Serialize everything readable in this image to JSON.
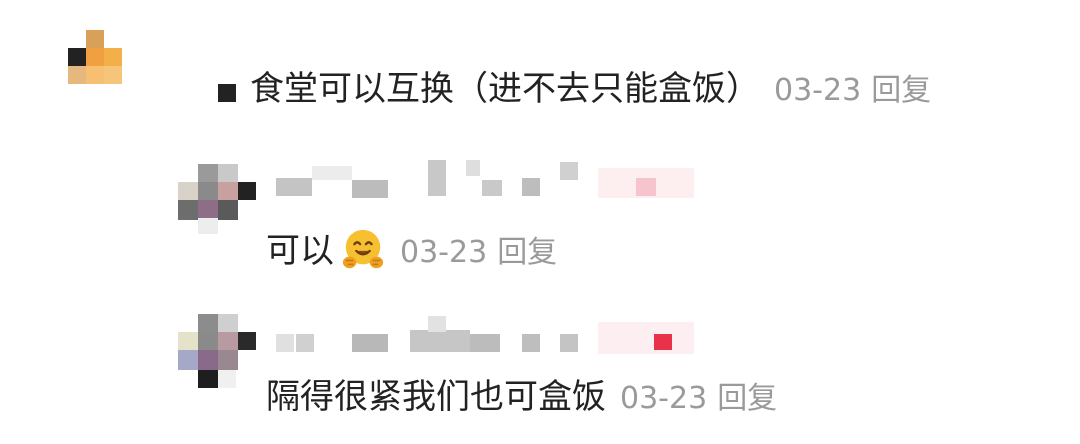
{
  "thread": {
    "top_comment": {
      "text": "食堂可以互换（进不去只能盒饭）",
      "date": "03-23",
      "reply_label": "回复"
    },
    "replies": [
      {
        "text": "可以",
        "emoji": "hugging-face",
        "date": "03-23",
        "reply_label": "回复"
      },
      {
        "text": "隔得很紧我们也可盒饭",
        "date": "03-23",
        "reply_label": "回复"
      }
    ]
  },
  "colors": {
    "text": "#222222",
    "meta": "#9a9a9a",
    "background": "#ffffff"
  }
}
